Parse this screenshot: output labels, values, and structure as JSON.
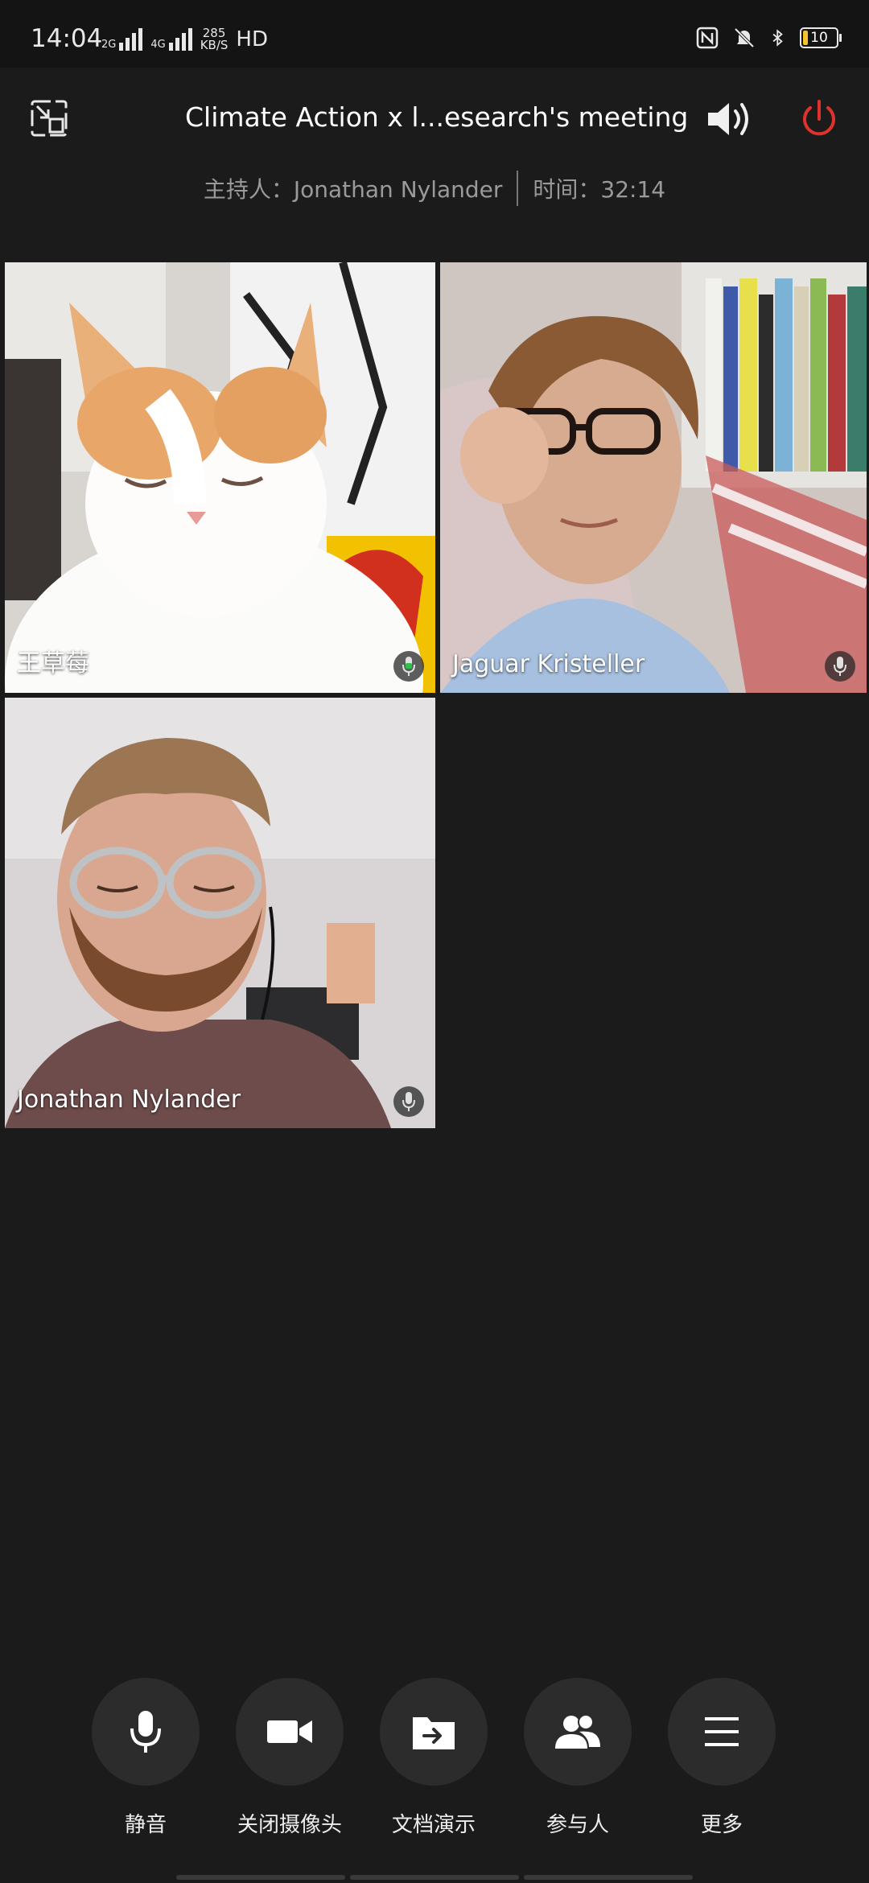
{
  "status_bar": {
    "time": "14:04",
    "sim1_tag": "2G",
    "sim2_tag": "4G",
    "net_rate": "285",
    "net_unit": "KB/S",
    "hd_label": "HD",
    "battery_level": "10",
    "icons": [
      "nfc-icon",
      "vibrate-off-icon",
      "bluetooth-icon",
      "battery-icon"
    ]
  },
  "header": {
    "title": "Climate Action x l...esearch's meeting",
    "host_text": "主持人：Jonathan Nylander",
    "time_text": "时间：32:14"
  },
  "participants": [
    {
      "name": "王草莓",
      "mic_state": "speaking",
      "mic_color": "#2fbf4f"
    },
    {
      "name": "Jaguar Kristeller",
      "mic_state": "idle",
      "mic_color": "#e0e0e0"
    },
    {
      "name": "Jonathan Nylander",
      "mic_state": "idle",
      "mic_color": "#e0e0e0"
    }
  ],
  "controls": [
    {
      "label": "静音",
      "icon": "microphone-icon"
    },
    {
      "label": "关闭摄像头",
      "icon": "video-camera-icon"
    },
    {
      "label": "文档演示",
      "icon": "share-folder-icon"
    },
    {
      "label": "参与人",
      "icon": "participants-icon"
    },
    {
      "label": "更多",
      "icon": "menu-icon"
    }
  ],
  "colors": {
    "background": "#1b1b1b",
    "power_red": "#e0322d",
    "speaking_green": "#2fbf4f"
  }
}
